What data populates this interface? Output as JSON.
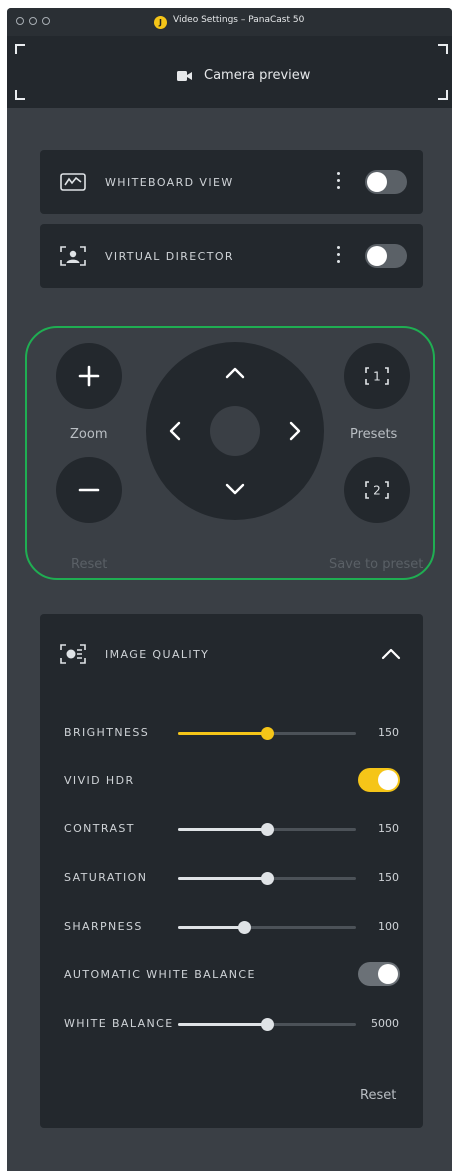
{
  "window": {
    "title": "Video Settings – PanaCast 50",
    "app_icon_letter": "J"
  },
  "preview": {
    "label": "Camera preview"
  },
  "features": [
    {
      "label": "WHITEBOARD VIEW",
      "icon": "whiteboard-icon",
      "enabled": false
    },
    {
      "label": "VIRTUAL DIRECTOR",
      "icon": "virtual-director-icon",
      "enabled": false
    }
  ],
  "ptz": {
    "zoom_label": "Zoom",
    "presets_label": "Presets",
    "preset_1": "1",
    "preset_2": "2",
    "reset_label": "Reset",
    "save_preset_label": "Save to preset",
    "accent_color": "#1fae52"
  },
  "image_quality": {
    "title": "IMAGE QUALITY",
    "expanded": true,
    "reset_label": "Reset",
    "rows": [
      {
        "label": "BRIGHTNESS",
        "type": "slider",
        "value": "150",
        "fraction": 0.5,
        "accent": "#f5c518"
      },
      {
        "label": "VIVID HDR",
        "type": "toggle",
        "on": true,
        "accent": "#f5c518"
      },
      {
        "label": "CONTRAST",
        "type": "slider",
        "value": "150",
        "fraction": 0.5,
        "accent": "#dfe3e6"
      },
      {
        "label": "SATURATION",
        "type": "slider",
        "value": "150",
        "fraction": 0.5,
        "accent": "#dfe3e6"
      },
      {
        "label": "SHARPNESS",
        "type": "slider",
        "value": "100",
        "fraction": 0.37,
        "accent": "#dfe3e6"
      },
      {
        "label": "AUTOMATIC WHITE BALANCE",
        "type": "toggle",
        "on": true,
        "accent": "#6b7177"
      },
      {
        "label": "WHITE BALANCE",
        "type": "slider",
        "value": "5000",
        "fraction": 0.5,
        "accent": "#dfe3e6"
      }
    ]
  }
}
